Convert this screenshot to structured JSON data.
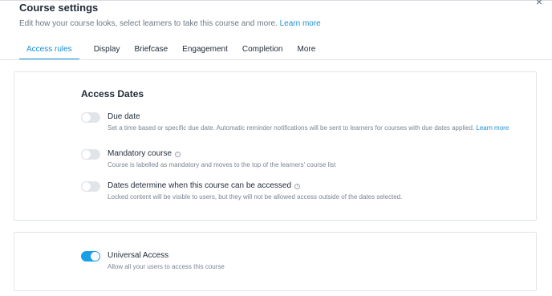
{
  "header": {
    "title": "Course settings",
    "subtitle": "Edit how your course looks, select learners to take this course and more.",
    "learn_more": "Learn more",
    "close_glyph": "×"
  },
  "tabs": [
    {
      "label": "Access rules",
      "active": true
    },
    {
      "label": "Display",
      "active": false
    },
    {
      "label": "Briefcase",
      "active": false
    },
    {
      "label": "Engagement",
      "active": false
    },
    {
      "label": "Completion",
      "active": false
    },
    {
      "label": "More",
      "active": false
    }
  ],
  "access_dates": {
    "title": "Access Dates",
    "rows": [
      {
        "label": "Due date",
        "desc": "Set a time based or specific due date. Automatic reminder notifications will be sent to learners for courses with due dates applied.",
        "link": "Learn more",
        "enabled": false
      },
      {
        "label": "Mandatory course",
        "desc": "Course is labelled as mandatory and moves to the top of the learners' course list",
        "enabled": false,
        "info": "i"
      },
      {
        "label": "Dates determine when this course can be accessed",
        "desc": "Locked content will be visible to users, but they will not be allowed access outside of the dates selected.",
        "enabled": false,
        "info": "i"
      }
    ]
  },
  "universal_access": {
    "label": "Universal Access",
    "desc": "Allow all your users to access this course",
    "enabled": true
  },
  "colors": {
    "accent": "#1a8fd6",
    "toggle_on": "#1aa0e6",
    "toggle_off": "#e1e5ea"
  }
}
